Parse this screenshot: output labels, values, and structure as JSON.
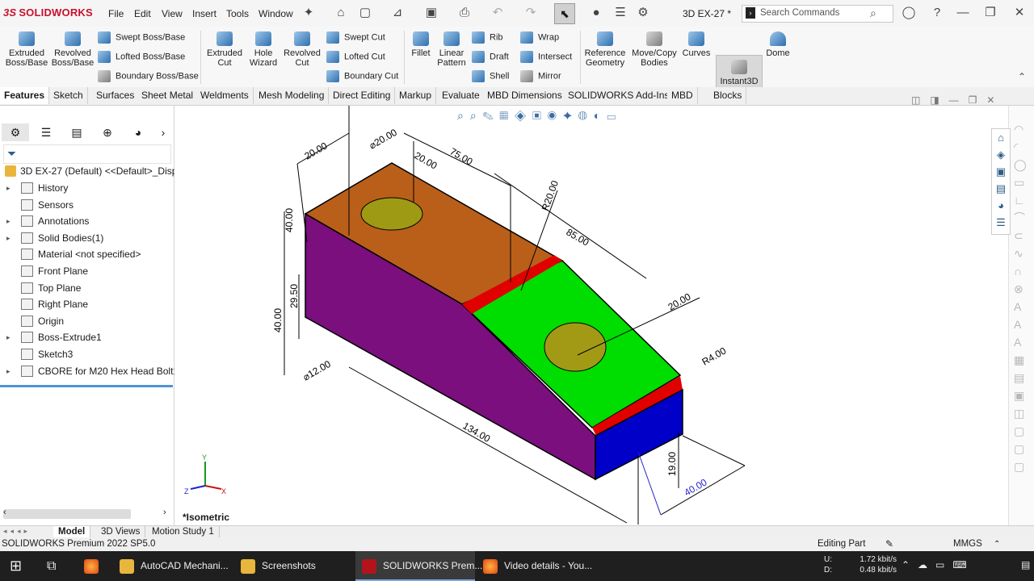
{
  "app": {
    "logo_text": "SOLIDWORKS",
    "logo_mark": "3S",
    "menu": [
      "File",
      "Edit",
      "View",
      "Insert",
      "Tools",
      "Window"
    ],
    "document_title": "3D EX-27 *",
    "search_placeholder": "Search Commands"
  },
  "ribbon": {
    "extruded_boss": "Extruded Boss/Base",
    "revolved_boss": "Revolved Boss/Base",
    "swept_boss": "Swept Boss/Base",
    "lofted_boss": "Lofted Boss/Base",
    "boundary_boss": "Boundary Boss/Base",
    "extruded_cut": "Extruded Cut",
    "hole_wizard": "Hole Wizard",
    "revolved_cut": "Revolved Cut",
    "swept_cut": "Swept Cut",
    "lofted_cut": "Lofted Cut",
    "boundary_cut": "Boundary Cut",
    "fillet": "Fillet",
    "linear_pattern": "Linear Pattern",
    "rib": "Rib",
    "draft": "Draft",
    "shell": "Shell",
    "wrap": "Wrap",
    "intersect": "Intersect",
    "mirror": "Mirror",
    "reference_geometry": "Reference Geometry",
    "move_copy_bodies": "Move/Copy Bodies",
    "curves": "Curves",
    "instant3d": "Instant3D",
    "dome": "Dome"
  },
  "tabs": [
    "Features",
    "Sketch",
    "Surfaces",
    "Sheet Metal",
    "Weldments",
    "Mesh Modeling",
    "Direct Editing",
    "Markup",
    "Evaluate",
    "MBD Dimensions",
    "SOLIDWORKS Add-Ins",
    "MBD",
    "Blocks"
  ],
  "tree": {
    "root": "3D EX-27 (Default) <<Default>_Display",
    "items": [
      {
        "label": "History",
        "arrow": "▸"
      },
      {
        "label": "Sensors",
        "arrow": ""
      },
      {
        "label": "Annotations",
        "arrow": "▸"
      },
      {
        "label": "Solid Bodies(1)",
        "arrow": "▸"
      },
      {
        "label": "Material <not specified>",
        "arrow": ""
      },
      {
        "label": "Front Plane",
        "arrow": ""
      },
      {
        "label": "Top Plane",
        "arrow": ""
      },
      {
        "label": "Right Plane",
        "arrow": ""
      },
      {
        "label": "Origin",
        "arrow": ""
      },
      {
        "label": "Boss-Extrude1",
        "arrow": "▸"
      },
      {
        "label": "Sketch3",
        "arrow": ""
      },
      {
        "label": "CBORE for M20 Hex Head Bolt1",
        "arrow": "▸"
      }
    ]
  },
  "viewport": {
    "view_label": "*Isometric",
    "dims": {
      "d1": "20.00",
      "d2": "⌀20.00",
      "d3": "20.00",
      "d4": "75.00",
      "d5": "R20.00",
      "d6": "85.00",
      "d7": "40.00",
      "d8": "29.50",
      "d9": "40.00",
      "d10": "⌀12.00",
      "d11": "20.00",
      "d12": "R4.00",
      "d13": "134.00",
      "d14": "19.00",
      "d15": "40.00"
    },
    "triad": {
      "y": "Y",
      "x": "X",
      "z": "Z"
    },
    "colors": {
      "top": "#b95f1a",
      "front": "#7a0f7d",
      "slope": "#00dd00",
      "red": "#e00000",
      "end": "#0000c8"
    }
  },
  "bottom_tabs": [
    "Model",
    "3D Views",
    "Motion Study 1"
  ],
  "status": {
    "product": "SOLIDWORKS Premium 2022 SP5.0",
    "mode": "Editing Part",
    "units": "MMGS"
  },
  "taskbar": {
    "apps": [
      "AutoCAD Mechani...",
      "Screenshots",
      "SOLIDWORKS Prem...",
      "Video details - You..."
    ],
    "net_up_label": "U:",
    "net_down_label": "D:",
    "net_up": "1.72 kbit/s",
    "net_down": "0.48 kbit/s"
  }
}
